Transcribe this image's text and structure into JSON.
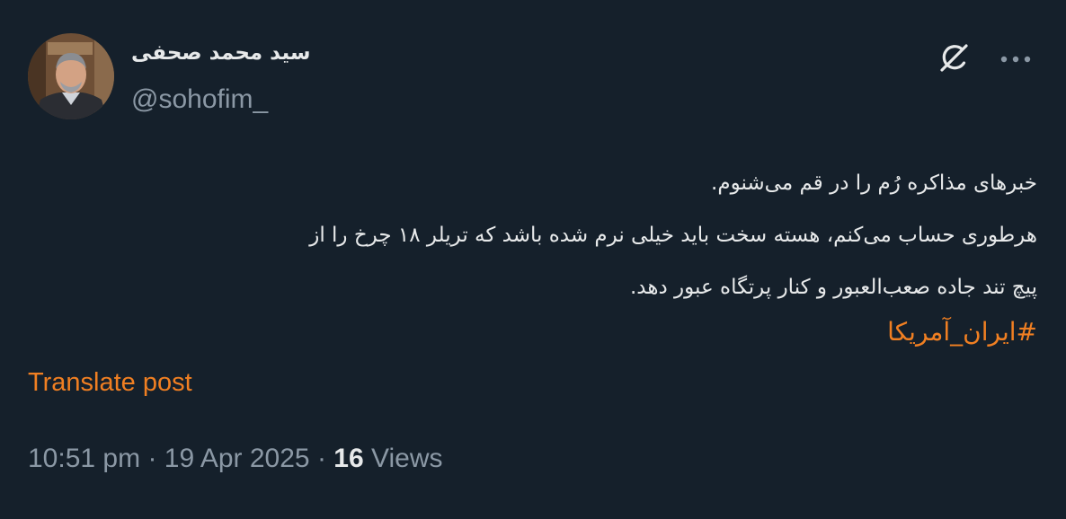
{
  "author": {
    "display_name": "سید محمد صحفی",
    "handle": "@sohofim_"
  },
  "header_icons": {
    "grok": "grok-icon",
    "more": "more-icon"
  },
  "post": {
    "lines": [
      "خبرهای مذاکره رُم را در قم می‌شنوم.",
      "هرطوری حساب می‌کنم، هسته سخت باید خیلی نرم شده باشد که تریلر ۱۸ چرخ را از",
      "پیچ تند جاده صعب‌العبور و کنار پرتگاه عبور دهد."
    ],
    "hashtag": "#ایران_آمریکا",
    "translate_label": "Translate post"
  },
  "meta": {
    "time": "10:51 pm",
    "separator": "·",
    "date": "19 Apr 2025",
    "views_count": "16",
    "views_label": "Views"
  },
  "colors": {
    "background": "#15202b",
    "text": "#e7e9ea",
    "secondary": "#8b98a5",
    "accent": "#f07f22"
  }
}
